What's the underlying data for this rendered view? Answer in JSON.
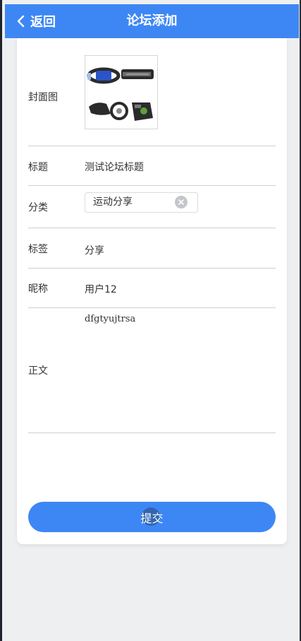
{
  "header": {
    "back_label": "返回",
    "title": "论坛添加"
  },
  "form": {
    "cover": {
      "label": "封面图"
    },
    "title": {
      "label": "标题",
      "value": "测试论坛标题"
    },
    "category": {
      "label": "分类",
      "value": "运动分享"
    },
    "tags": {
      "label": "标签",
      "value": "分享"
    },
    "nickname": {
      "label": "昵称",
      "value": "用户12"
    },
    "body": {
      "label": "正文",
      "value": "dfgtyujtrsa"
    }
  },
  "submit_label": "提交",
  "colors": {
    "primary": "#3d87f5",
    "background": "#eeeff1",
    "card": "#ffffff"
  }
}
